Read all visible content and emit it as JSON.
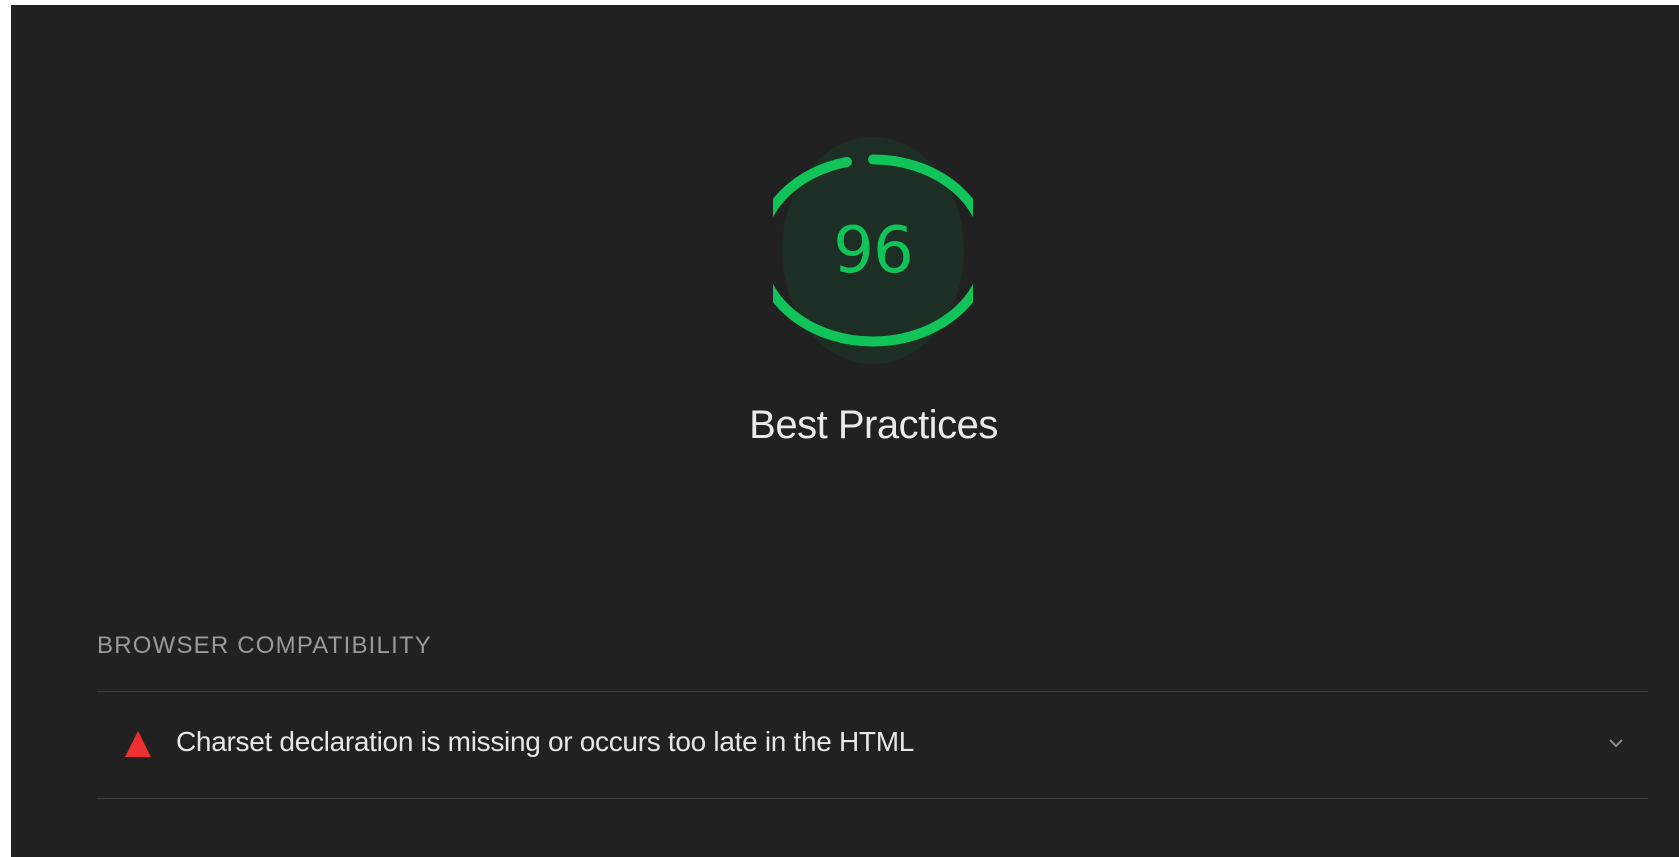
{
  "gauge": {
    "score": "96",
    "score_fraction": 0.96,
    "color": "#10c45a",
    "track_color": "#1d2e24"
  },
  "category": {
    "title": "Best Practices"
  },
  "group": {
    "title": "BROWSER COMPATIBILITY"
  },
  "audits": [
    {
      "title": "Charset declaration is missing or occurs too late in the HTML",
      "status": "fail",
      "status_icon": "warning-triangle-icon",
      "status_color": "#ee2f2f",
      "expand_icon": "chevron-down-icon"
    }
  ]
}
